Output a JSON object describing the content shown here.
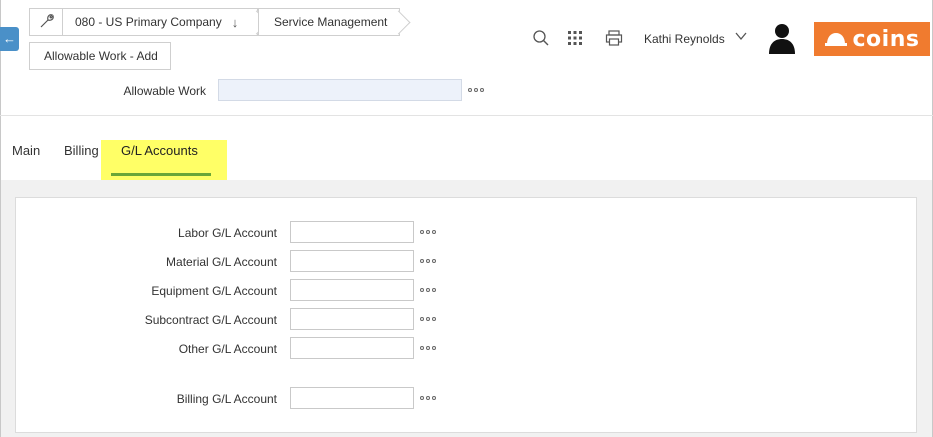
{
  "breadcrumb": {
    "tool_icon": "wrench-icon",
    "company": "080 - US Primary Company",
    "company_icon": "arrow-down-icon",
    "module": "Service Management",
    "page": "Allowable Work - Add"
  },
  "header": {
    "back_icon": "arrow-left-icon",
    "search_icon": "search-icon",
    "apps_icon": "grid-icon",
    "print_icon": "printer-icon",
    "user_name": "Kathi Reynolds",
    "user_caret_icon": "chevron-down-icon",
    "avatar_icon": "user-avatar-icon",
    "logo_text": "coins",
    "logo_color": "#f07b2f"
  },
  "key_field": {
    "label": "Allowable Work",
    "value": ""
  },
  "tabs": [
    {
      "label": "Main",
      "active": false
    },
    {
      "label": "Billing",
      "active": false
    },
    {
      "label": "G/L Accounts",
      "active": true
    }
  ],
  "accent": {
    "tab_underline": "#6aa637",
    "highlight": "#ffff66"
  },
  "gl_accounts": [
    {
      "label": "Labor G/L Account",
      "value": ""
    },
    {
      "label": "Material G/L Account",
      "value": ""
    },
    {
      "label": "Equipment G/L Account",
      "value": ""
    },
    {
      "label": "Subcontract G/L Account",
      "value": ""
    },
    {
      "label": "Other G/L Account",
      "value": ""
    },
    {
      "label": "Billing G/L Account",
      "value": ""
    }
  ]
}
